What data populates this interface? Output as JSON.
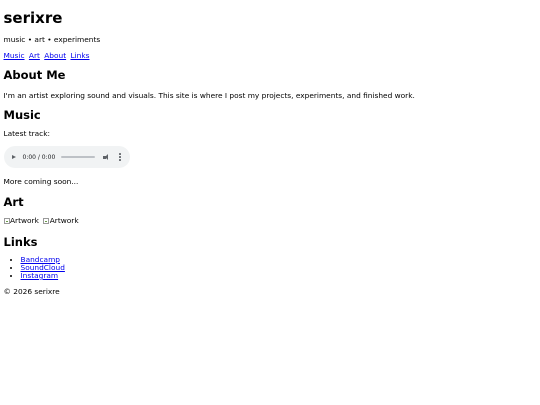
{
  "site": {
    "title": "serixre",
    "tagline": "music • art • experiments"
  },
  "nav": [
    {
      "label": "Music"
    },
    {
      "label": "Art"
    },
    {
      "label": "About"
    },
    {
      "label": "Links"
    }
  ],
  "about": {
    "heading": "About Me",
    "text": "I'm an artist exploring sound and visuals. This site is where I post my projects, experiments, and finished work."
  },
  "music": {
    "heading": "Music",
    "latest_label": "Latest track:",
    "player": {
      "time": "0:00 / 0:00",
      "progress": 0
    },
    "coming": "More coming soon..."
  },
  "art": {
    "heading": "Art",
    "images": [
      {
        "alt": "Artwork"
      },
      {
        "alt": "Artwork"
      }
    ]
  },
  "links": {
    "heading": "Links",
    "items": [
      {
        "label": "Bandcamp"
      },
      {
        "label": "SoundCloud"
      },
      {
        "label": "Instagram"
      }
    ]
  },
  "footer": {
    "text": "© 2026 serixre"
  },
  "colors": {
    "link": "#0000ee",
    "player_bg": "#f1f3f4"
  }
}
